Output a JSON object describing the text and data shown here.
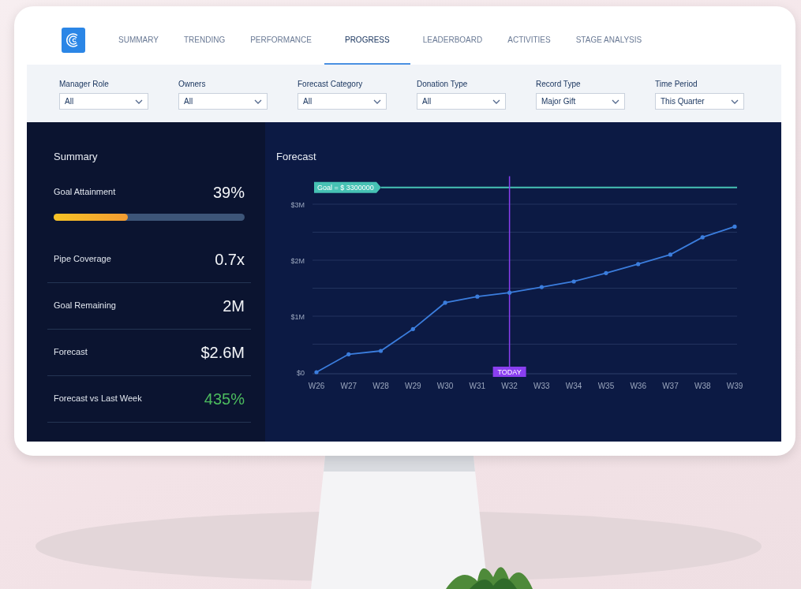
{
  "tabs": [
    {
      "label": "SUMMARY",
      "selected": false
    },
    {
      "label": "TRENDING",
      "selected": false
    },
    {
      "label": "PERFORMANCE",
      "selected": false
    },
    {
      "label": "PROGRESS",
      "selected": true
    },
    {
      "label": "LEADERBOARD",
      "selected": false
    },
    {
      "label": "ACTIVITIES",
      "selected": false
    },
    {
      "label": "STAGE ANALYSIS",
      "selected": false
    }
  ],
  "filters": [
    {
      "label": "Manager Role",
      "value": "All"
    },
    {
      "label": "Owners",
      "value": "All"
    },
    {
      "label": "Forecast Category",
      "value": "All"
    },
    {
      "label": "Donation Type",
      "value": "All"
    },
    {
      "label": "Record Type",
      "value": "Major Gift"
    },
    {
      "label": "Time Period",
      "value": "This Quarter"
    }
  ],
  "summary": {
    "title": "Summary",
    "goal": {
      "label": "Goal Attainment",
      "value": "39%",
      "level": 0.39
    },
    "metrics": [
      {
        "label": "Pipe Coverage",
        "value": "0.7x",
        "highlight": false
      },
      {
        "label": "Goal Remaining",
        "value": "2M",
        "highlight": false
      },
      {
        "label": "Forecast",
        "value": "$2.6M",
        "highlight": false
      },
      {
        "label": "Forecast vs Last Week",
        "value": "435%",
        "highlight": true
      }
    ]
  },
  "forecast": {
    "chart_data": {
      "type": "line",
      "title": "Forecast",
      "categories": [
        "W26",
        "W27",
        "W28",
        "W29",
        "W30",
        "W31",
        "W32",
        "W33",
        "W34",
        "W35",
        "W36",
        "W37",
        "W38",
        "W39"
      ],
      "series": [
        {
          "color": "#3b7ddd",
          "values": [
            0,
            0.32,
            0.38,
            0.77,
            1.24,
            1.35,
            1.42,
            1.52,
            1.62,
            1.77,
            1.93,
            2.1,
            2.41,
            2.6
          ]
        }
      ],
      "grid": true,
      "ylim": [
        0,
        3.5
      ],
      "yticks": [
        {
          "value": 0,
          "label": "$0"
        },
        {
          "value": 1,
          "label": "$1M"
        },
        {
          "value": 2,
          "label": "$2M"
        },
        {
          "value": 3,
          "label": "$3M"
        }
      ],
      "ref_lines": [
        {
          "axis": "y",
          "value": 3.3,
          "label": "Goal = $ 3300000"
        },
        {
          "axis": "x",
          "value": "W32",
          "label": "TODAY"
        }
      ]
    }
  }
}
